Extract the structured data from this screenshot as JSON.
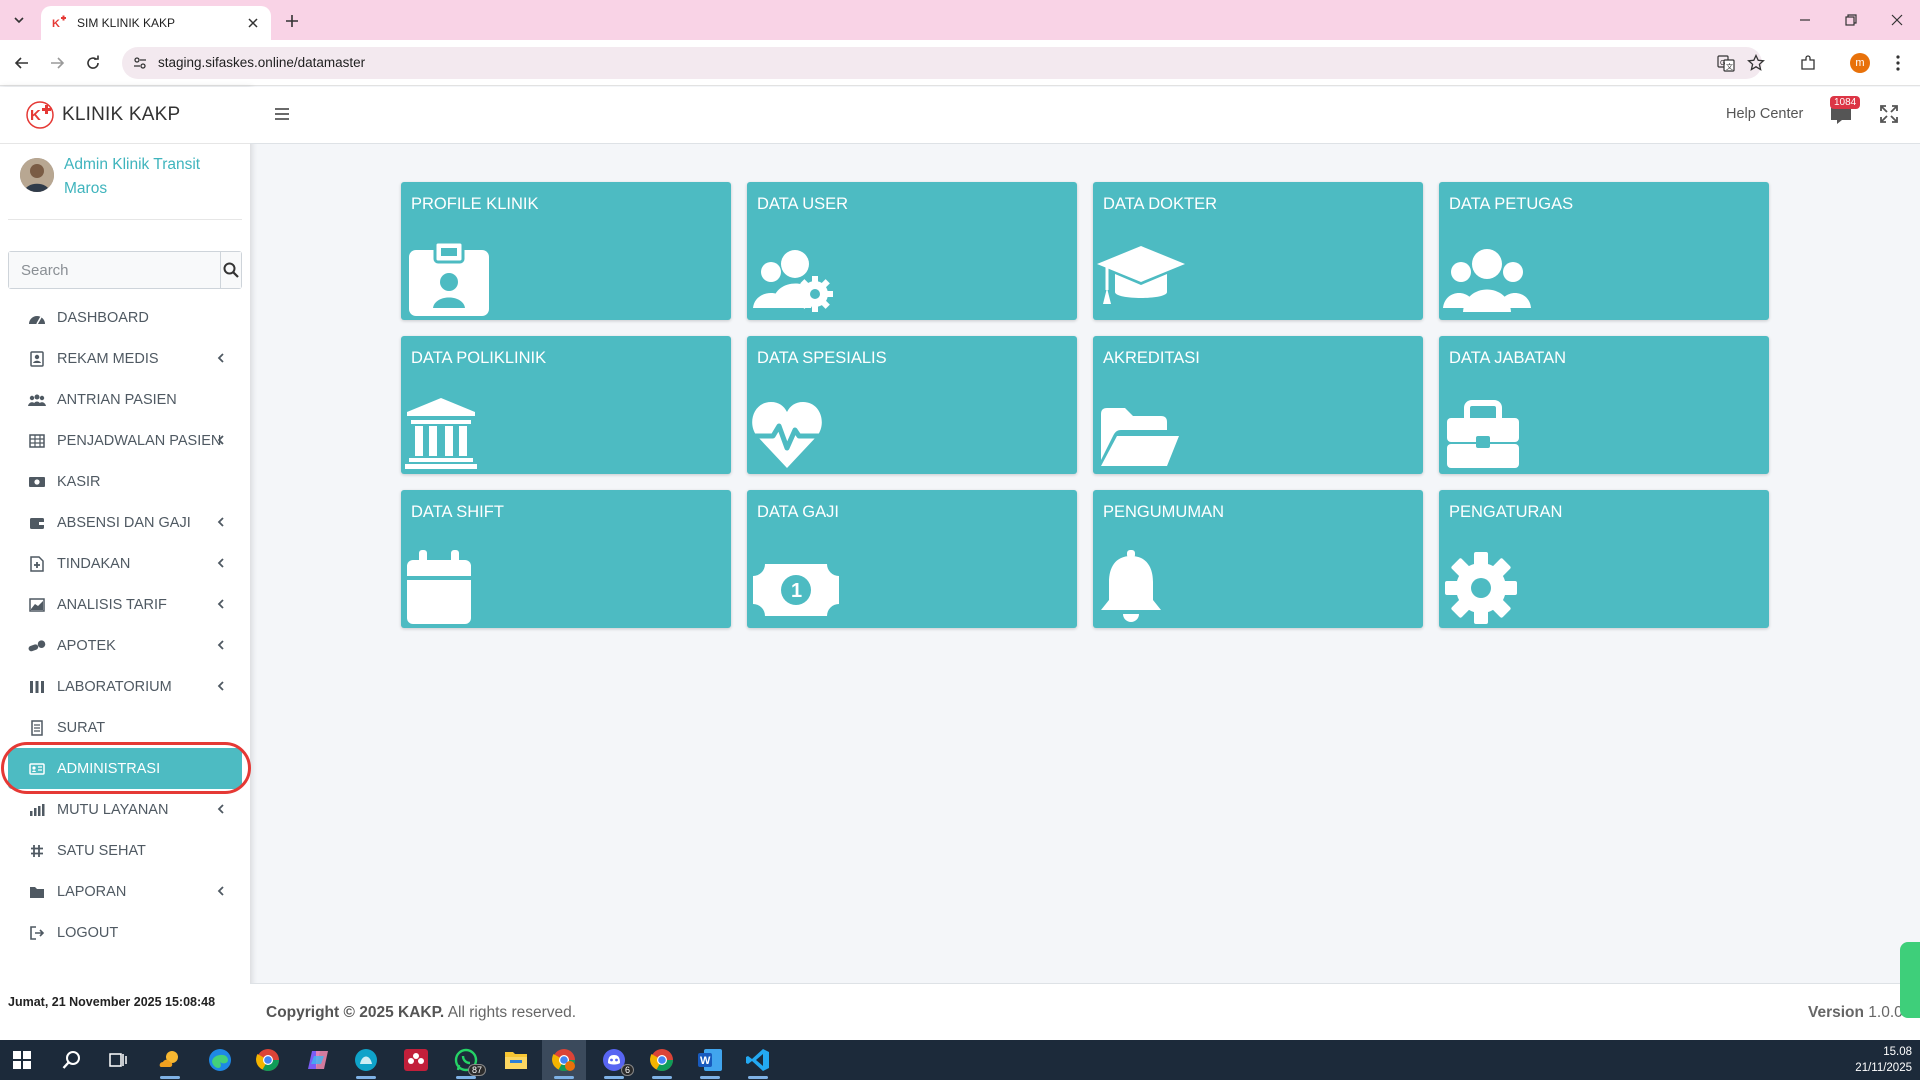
{
  "browser": {
    "tab_title": "SIM KLINIK KAKP",
    "url": "staging.sifaskes.online/datamaster",
    "profile_initial": "m"
  },
  "sidebar": {
    "brand": "KLINIK KAKP",
    "user_name": "Admin Klinik Transit Maros",
    "search_placeholder": "Search",
    "items": [
      {
        "label": "DASHBOARD",
        "icon": "dashboard-icon",
        "has_chevron": false
      },
      {
        "label": "REKAM MEDIS",
        "icon": "id-card-icon",
        "has_chevron": true
      },
      {
        "label": "ANTRIAN PASIEN",
        "icon": "queue-icon",
        "has_chevron": false
      },
      {
        "label": "PENJADWALAN PASIEN",
        "icon": "table-icon",
        "has_chevron": true
      },
      {
        "label": "KASIR",
        "icon": "cash-icon",
        "has_chevron": false
      },
      {
        "label": "ABSENSI DAN GAJI",
        "icon": "wallet-icon",
        "has_chevron": true
      },
      {
        "label": "TINDAKAN",
        "icon": "medical-file-icon",
        "has_chevron": true
      },
      {
        "label": "ANALISIS TARIF",
        "icon": "chart-area-icon",
        "has_chevron": true
      },
      {
        "label": "APOTEK",
        "icon": "pills-icon",
        "has_chevron": true
      },
      {
        "label": "LABORATORIUM",
        "icon": "lab-icon",
        "has_chevron": true
      },
      {
        "label": "SURAT",
        "icon": "document-icon",
        "has_chevron": false
      },
      {
        "label": "ADMINISTRASI",
        "icon": "admin-card-icon",
        "has_chevron": false,
        "active": true
      },
      {
        "label": "MUTU LAYANAN",
        "icon": "bar-chart-icon",
        "has_chevron": true
      },
      {
        "label": "SATU SEHAT",
        "icon": "hashtag-icon",
        "has_chevron": false
      },
      {
        "label": "LAPORAN",
        "icon": "folder-icon",
        "has_chevron": true
      },
      {
        "label": "LOGOUT",
        "icon": "logout-icon",
        "has_chevron": false
      }
    ],
    "clock": "Jumat, 21 November 2025 15:08:48"
  },
  "header": {
    "help_center": "Help Center",
    "notification_count": "1084"
  },
  "tiles": [
    {
      "title": "PROFILE KLINIK",
      "icon": "id-badge-icon"
    },
    {
      "title": "DATA USER",
      "icon": "users-cog-icon"
    },
    {
      "title": "DATA DOKTER",
      "icon": "graduation-cap-icon"
    },
    {
      "title": "DATA PETUGAS",
      "icon": "users-icon"
    },
    {
      "title": "DATA POLIKLINIK",
      "icon": "institution-icon"
    },
    {
      "title": "DATA SPESIALIS",
      "icon": "heartbeat-icon"
    },
    {
      "title": "AKREDITASI",
      "icon": "folder-open-icon"
    },
    {
      "title": "DATA JABATAN",
      "icon": "briefcase-icon"
    },
    {
      "title": "DATA SHIFT",
      "icon": "calendar-icon"
    },
    {
      "title": "DATA GAJI",
      "icon": "money-bill-icon"
    },
    {
      "title": "PENGUMUMAN",
      "icon": "bell-icon"
    },
    {
      "title": "PENGATURAN",
      "icon": "gear-icon"
    }
  ],
  "footer": {
    "copyright_bold": "Copyright © 2025 KAKP.",
    "copyright_rest": " All rights reserved.",
    "version_label": "Version",
    "version_value": " 1.0.0"
  },
  "taskbar": {
    "whatsapp_badge": "87",
    "discord_badge": "6",
    "time": "15.08",
    "date": "21/11/2025"
  },
  "colors": {
    "accent": "#4dbbc2",
    "tab_bar": "#f9d3e6",
    "highlight_ring": "#e53935",
    "badge": "#dc3545"
  }
}
